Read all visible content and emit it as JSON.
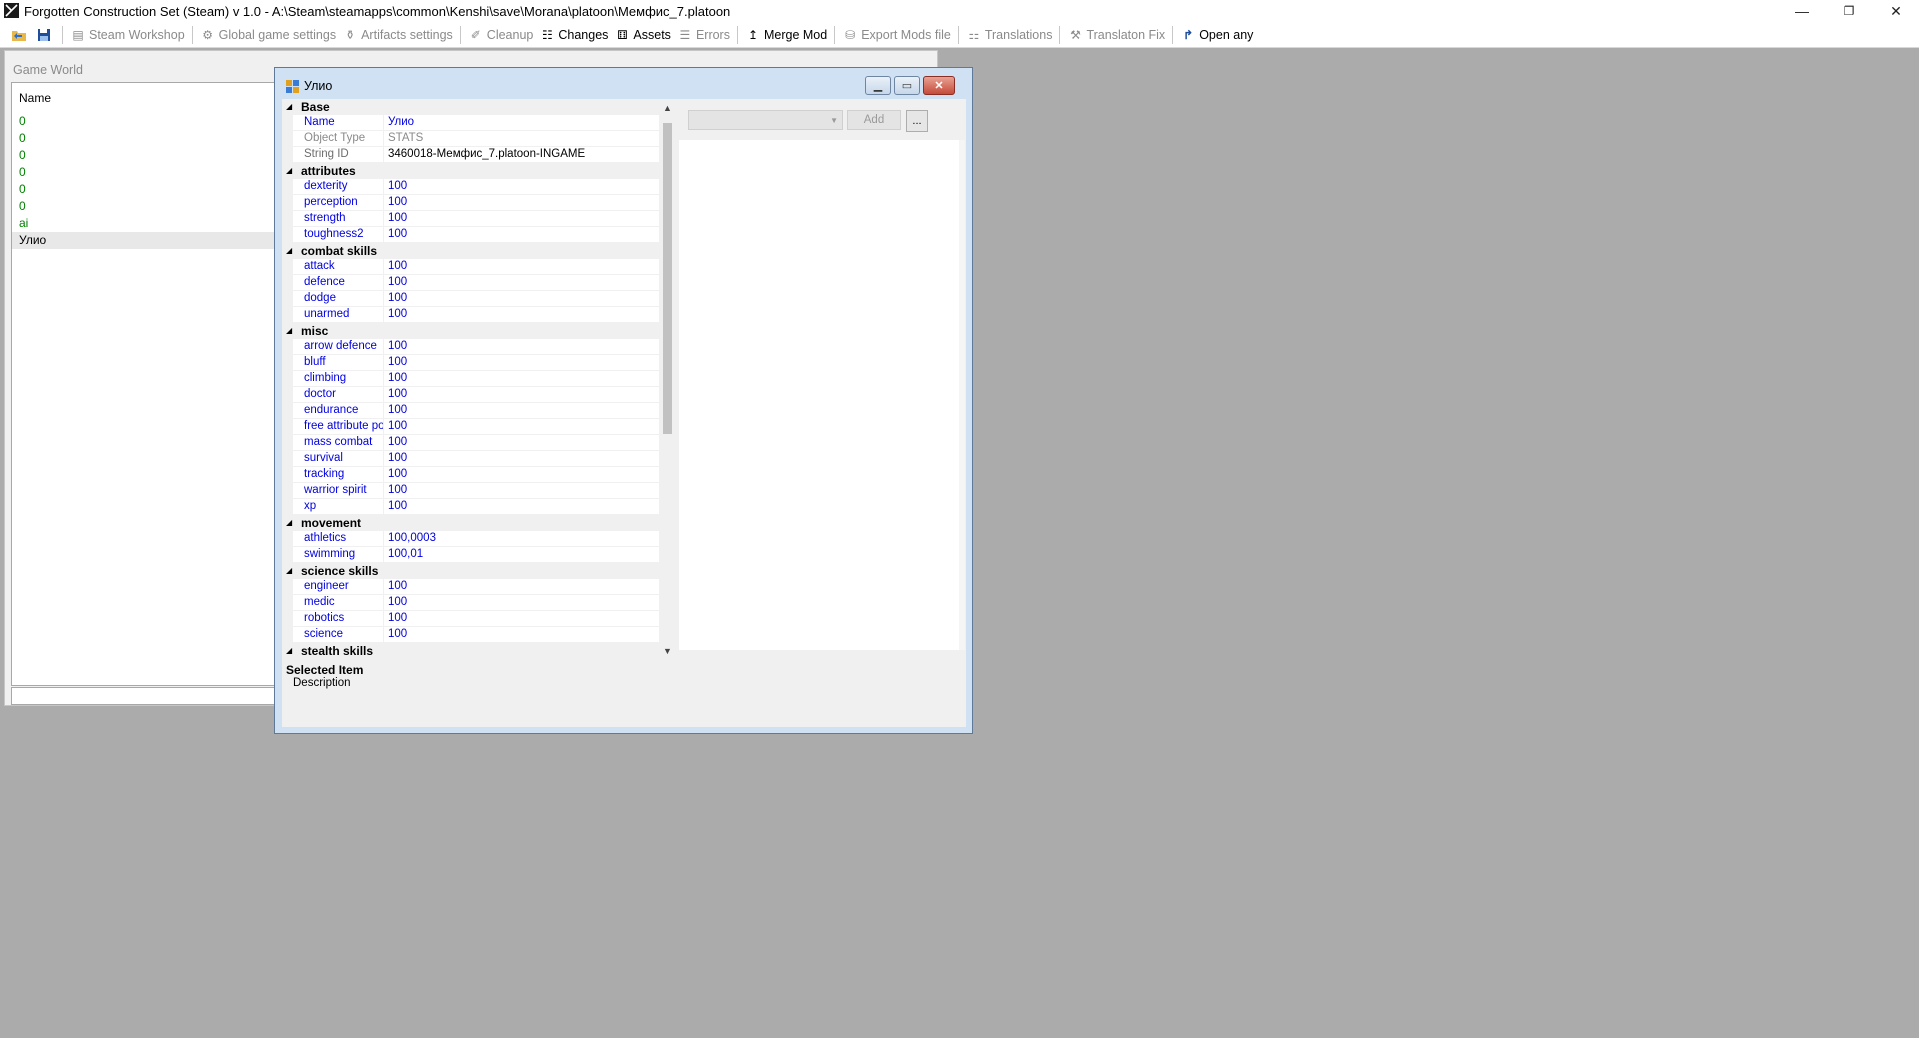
{
  "window": {
    "title": "Forgotten Construction Set (Steam) v 1.0 - A:\\Steam\\steamapps\\common\\Kenshi\\save\\Morana\\platoon\\Мемфис_7.platoon",
    "controls": {
      "minimize": "—",
      "restore": "❐",
      "close": "✕"
    }
  },
  "toolbar": {
    "items": [
      {
        "label": "Steam Workshop",
        "icon": "workshop-icon",
        "enabled": false
      },
      {
        "label": "Global game settings",
        "icon": "gear-icon",
        "enabled": false
      },
      {
        "label": "Artifacts settings",
        "icon": "artifact-icon",
        "enabled": false
      },
      {
        "label": "Cleanup",
        "icon": "broom-icon",
        "enabled": false
      },
      {
        "label": "Changes",
        "icon": "changes-icon",
        "enabled": true
      },
      {
        "label": "Assets",
        "icon": "assets-icon",
        "enabled": true
      },
      {
        "label": "Errors",
        "icon": "errors-icon",
        "enabled": false
      },
      {
        "label": "Merge Mod",
        "icon": "merge-icon",
        "enabled": true
      },
      {
        "label": "Export Mods file",
        "icon": "export-icon",
        "enabled": false
      },
      {
        "label": "Translations",
        "icon": "translations-icon",
        "enabled": false
      },
      {
        "label": "Translaton Fix",
        "icon": "translation-fix-icon",
        "enabled": false
      },
      {
        "label": "Open any",
        "icon": "open-any-icon",
        "enabled": true
      }
    ]
  },
  "game_world": {
    "title": "Game World",
    "column_header": "Name",
    "rows": [
      "0",
      "0",
      "0",
      "0",
      "0",
      "0",
      "ai",
      "Улио"
    ],
    "selected_index": 7
  },
  "dialog": {
    "title": "Улио",
    "categories": [
      {
        "name": "Base",
        "rows": [
          {
            "name": "Name",
            "value": "Улио",
            "kind": "base-blue"
          },
          {
            "name": "Object Type",
            "value": "STATS",
            "kind": "readonly"
          },
          {
            "name": "String ID",
            "value": "3460018-Мемфис_7.platoon-INGAME",
            "kind": "base"
          }
        ]
      },
      {
        "name": "attributes",
        "rows": [
          {
            "name": "dexterity",
            "value": "100"
          },
          {
            "name": "perception",
            "value": "100"
          },
          {
            "name": "strength",
            "value": "100"
          },
          {
            "name": "toughness2",
            "value": "100"
          }
        ]
      },
      {
        "name": "combat skills",
        "rows": [
          {
            "name": "attack",
            "value": "100"
          },
          {
            "name": "defence",
            "value": "100"
          },
          {
            "name": "dodge",
            "value": "100"
          },
          {
            "name": "unarmed",
            "value": "100"
          }
        ]
      },
      {
        "name": "misc",
        "rows": [
          {
            "name": "arrow defence",
            "value": "100"
          },
          {
            "name": "bluff",
            "value": "100"
          },
          {
            "name": "climbing",
            "value": "100"
          },
          {
            "name": "doctor",
            "value": "100"
          },
          {
            "name": "endurance",
            "value": "100"
          },
          {
            "name": "free attribute points",
            "value": "100"
          },
          {
            "name": "mass combat",
            "value": "100"
          },
          {
            "name": "survival",
            "value": "100"
          },
          {
            "name": "tracking",
            "value": "100"
          },
          {
            "name": "warrior spirit",
            "value": "100"
          },
          {
            "name": "xp",
            "value": "100"
          }
        ]
      },
      {
        "name": "movement",
        "rows": [
          {
            "name": "athletics",
            "value": "100,0003"
          },
          {
            "name": "swimming",
            "value": "100,01"
          }
        ]
      },
      {
        "name": "science skills",
        "rows": [
          {
            "name": "engineer",
            "value": "100"
          },
          {
            "name": "medic",
            "value": "100"
          },
          {
            "name": "robotics",
            "value": "100"
          },
          {
            "name": "science",
            "value": "100"
          }
        ]
      },
      {
        "name": "stealth skills",
        "rows": []
      }
    ],
    "description": {
      "title": "Selected Item",
      "text": "Description"
    },
    "right_panel": {
      "add_label": "Add",
      "dots_label": "..."
    }
  }
}
